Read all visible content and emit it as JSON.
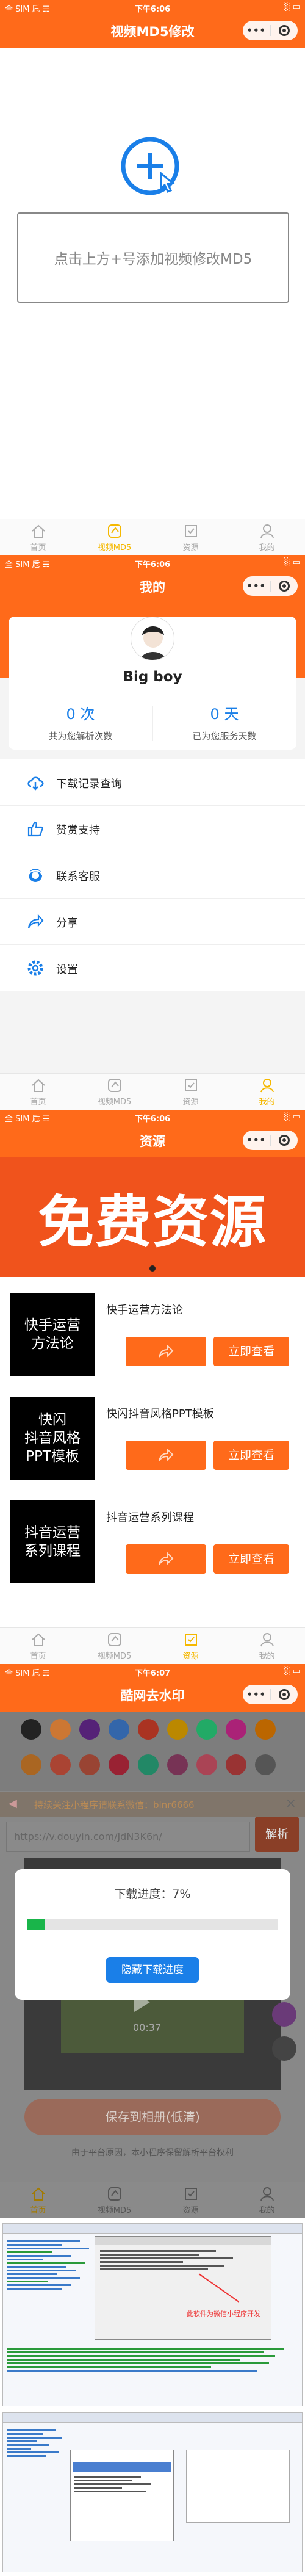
{
  "statusbar": {
    "carrier": "全 SIM 卮 ☴",
    "battery": "░ ▭"
  },
  "screen1": {
    "time": "下午6:06",
    "title": "视频MD5修改",
    "hint": "点击上方+号添加视频修改MD5"
  },
  "tabs": [
    "首页",
    "视频MD5",
    "资源",
    "我的"
  ],
  "capsule": {
    "dots": "•••"
  },
  "screen2": {
    "time": "下午6:06",
    "title": "我的",
    "username": "Big boy",
    "stats": [
      {
        "value": "0 次",
        "label": "共为您解析次数"
      },
      {
        "value": "0 天",
        "label": "已为您服务天数"
      }
    ],
    "menu": [
      "下载记录查询",
      "赞赏支持",
      "联系客服",
      "分享",
      "设置"
    ]
  },
  "screen3": {
    "time": "下午6:06",
    "title": "资源",
    "banner": "免费资源",
    "view_label": "立即查看",
    "items": [
      {
        "thumb_l1": "快手运营",
        "thumb_l2": "方法论",
        "thumb_l3": "",
        "title": "快手运营方法论"
      },
      {
        "thumb_l1": "快闪",
        "thumb_l2": "抖音风格",
        "thumb_l3": "PPT模板",
        "title": "快闪抖音风格PPT模板"
      },
      {
        "thumb_l1": "抖音运营",
        "thumb_l2": "系列课程",
        "thumb_l3": "",
        "title": "抖音运营系列课程"
      }
    ]
  },
  "screen4": {
    "time": "下午6:07",
    "title": "酷网去水印",
    "notice": "持续关注小程序请联系微信：blnr6666",
    "url": "https://v.douyin.com/JdN3K6n/",
    "parse": "解析",
    "modal_label": "下载进度：7%",
    "progress": 0.07,
    "hide_btn": "隐藏下载进度",
    "save_btn": "保存到相册(低清)",
    "duration": "00:37",
    "footnote": "由于平台原因，本小程序保留解析平台权利"
  },
  "screen5": {
    "caption": "此软件为微信小程序开发"
  },
  "colors": {
    "accent": "#ff6a1a",
    "tab_active": "#f5b800",
    "blue": "#1a7fe8"
  }
}
